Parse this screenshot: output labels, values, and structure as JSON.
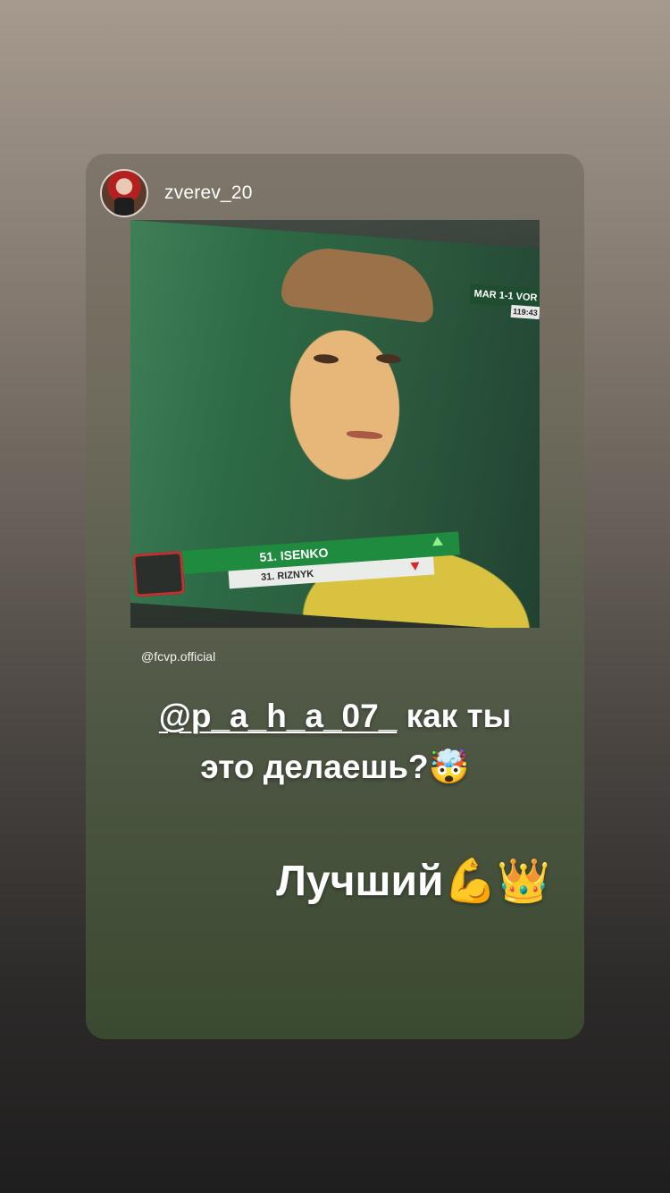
{
  "story": {
    "username": "zverev_20",
    "photo_credit": "@fcvp.official",
    "tv": {
      "score_text": "MAR 1-1 VOR",
      "time_text": "119:43",
      "player_in": "51. ISENKO",
      "player_out": "31. RIZNYK"
    },
    "caption": {
      "mention": "@p_a_h_a_07_",
      "line1_rest": "как ты",
      "line2": "это делаешь?",
      "line2_emoji": "🤯",
      "line3": "Лучший",
      "line3_emojis": "💪👑"
    }
  },
  "colors": {
    "tv_green": "#1f8b3e",
    "text": "#ffffff"
  },
  "icons": {
    "avatar": "user-avatar",
    "sub_in": "arrow-up-icon",
    "sub_out": "arrow-down-icon"
  }
}
